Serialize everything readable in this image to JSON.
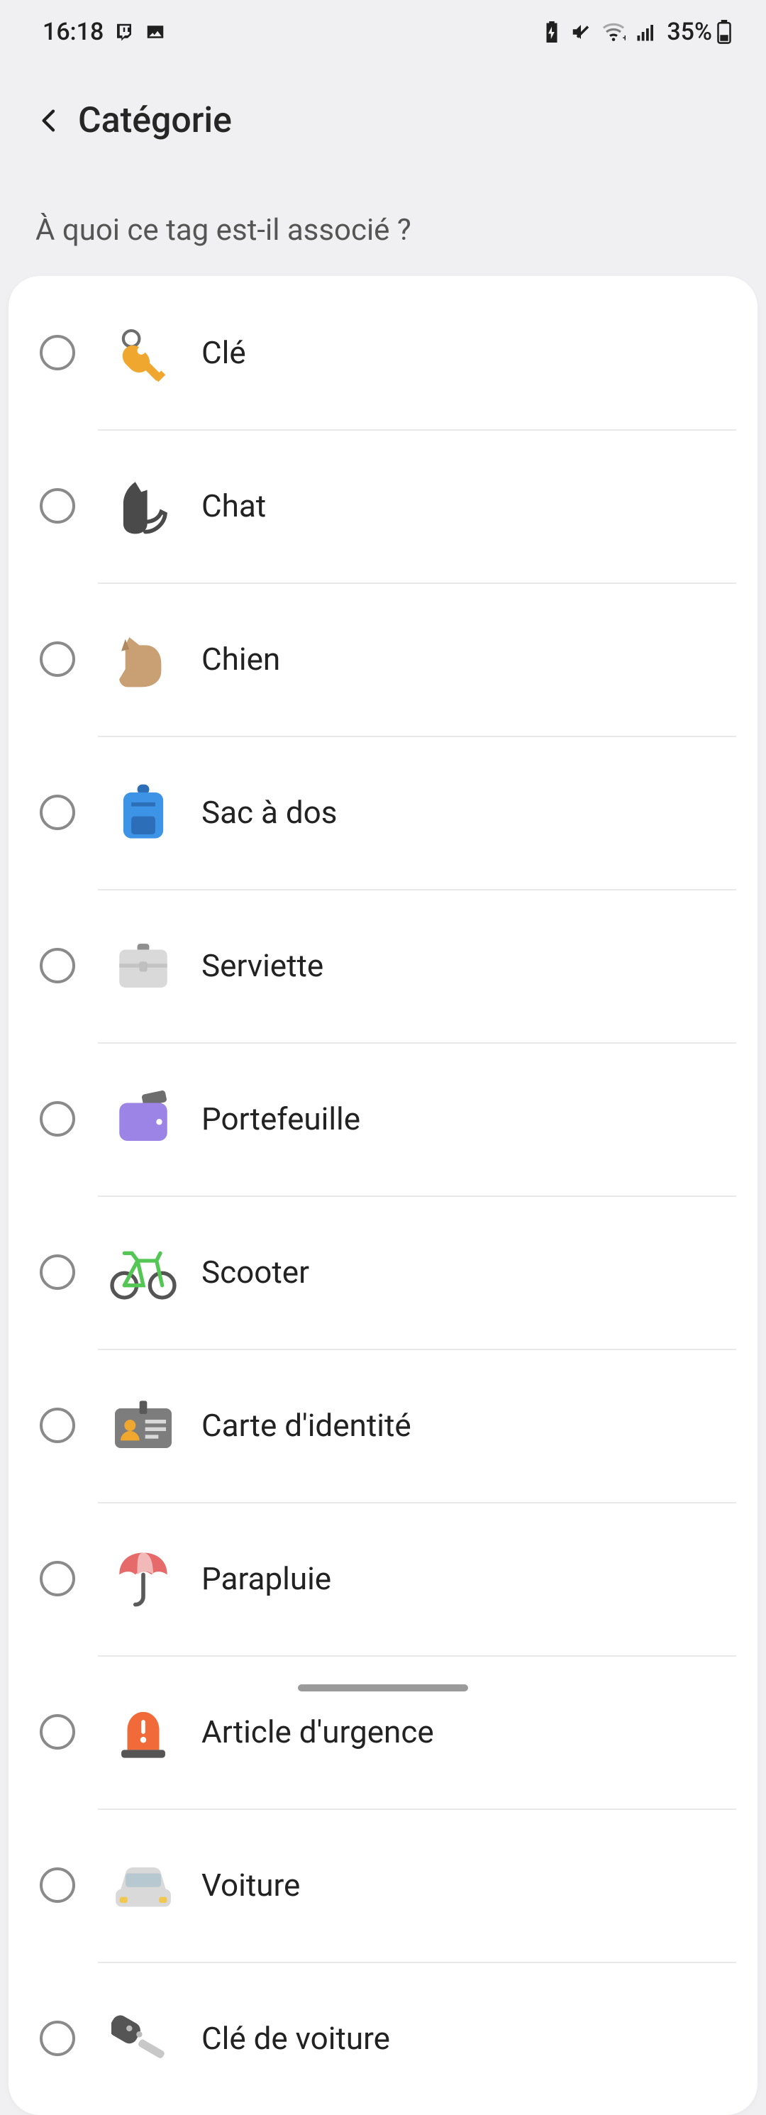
{
  "status_bar": {
    "time": "16:18",
    "battery_pct": "35%"
  },
  "header": {
    "title": "Catégorie"
  },
  "question": "À quoi ce tag est-il associé ?",
  "categories": [
    {
      "id": "key",
      "label": "Clé"
    },
    {
      "id": "cat",
      "label": "Chat"
    },
    {
      "id": "dog",
      "label": "Chien"
    },
    {
      "id": "backpack",
      "label": "Sac à dos"
    },
    {
      "id": "briefcase",
      "label": "Serviette"
    },
    {
      "id": "wallet",
      "label": "Portefeuille"
    },
    {
      "id": "bicycle",
      "label": "Scooter"
    },
    {
      "id": "id-card",
      "label": "Carte d'identité"
    },
    {
      "id": "umbrella",
      "label": "Parapluie"
    },
    {
      "id": "emergency",
      "label": "Article d'urgence"
    },
    {
      "id": "car",
      "label": "Voiture"
    },
    {
      "id": "car-key",
      "label": "Clé de voiture"
    }
  ]
}
